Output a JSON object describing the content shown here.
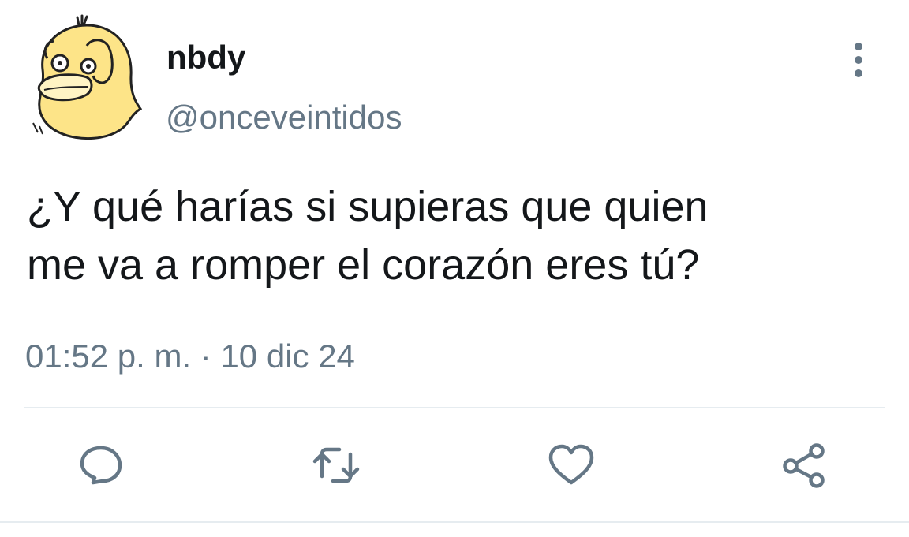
{
  "tweet": {
    "display_name": "nbdy",
    "handle": "@onceveintidos",
    "text": "¿Y qué harías si supieras que quien\nme va a romper el corazón eres tú?",
    "timestamp": "01:52 p. m. · 10 dic 24"
  },
  "avatar": {
    "icon": "yellow-duck-avatar",
    "color": "#fde488"
  },
  "actions": [
    {
      "icon": "reply-icon"
    },
    {
      "icon": "retweet-icon"
    },
    {
      "icon": "like-icon"
    },
    {
      "icon": "share-icon"
    }
  ],
  "colors": {
    "text": "#14171a",
    "secondary": "#657786",
    "divider": "#e6ecf0",
    "avatar_yellow": "#fde488"
  }
}
